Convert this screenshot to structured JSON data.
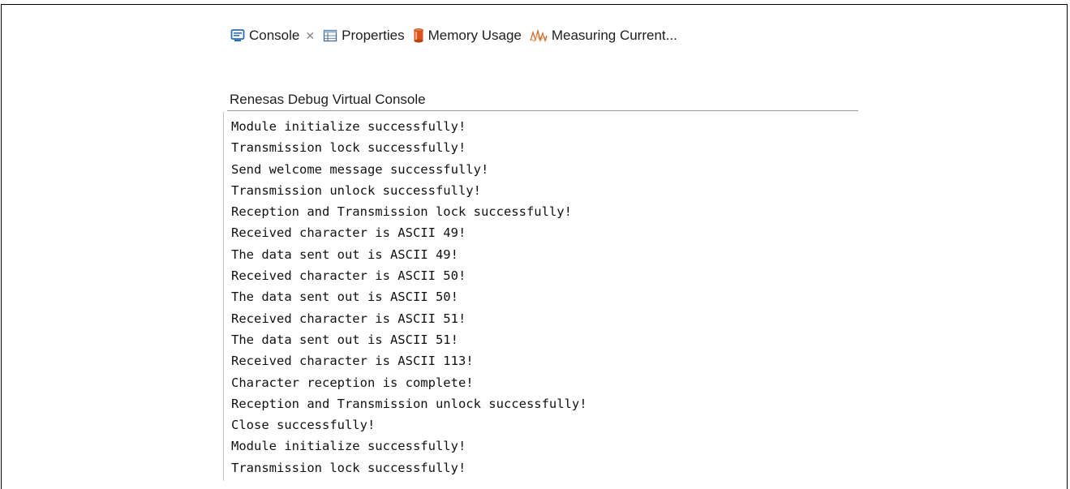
{
  "tabs": [
    {
      "label": "Console",
      "icon": "console-icon",
      "closable": true,
      "active": true
    },
    {
      "label": "Properties",
      "icon": "properties-icon",
      "closable": false
    },
    {
      "label": "Memory Usage",
      "icon": "memory-icon",
      "closable": false
    },
    {
      "label": "Measuring Current...",
      "icon": "measuring-icon",
      "closable": false
    }
  ],
  "close_glyph": "✕",
  "console": {
    "title": "Renesas Debug Virtual Console",
    "lines": [
      "Module initialize successfully!",
      "Transmission lock successfully!",
      "Send welcome message successfully!",
      "Transmission unlock successfully!",
      "Reception and Transmission lock successfully!",
      "Received character is ASCII 49!",
      "The data sent out is ASCII 49!",
      "Received character is ASCII 50!",
      "The data sent out is ASCII 50!",
      "Received character is ASCII 51!",
      "The data sent out is ASCII 51!",
      "Received character is ASCII 113!",
      "Character reception is complete!",
      "Reception and Transmission unlock successfully!",
      "Close successfully!",
      "Module initialize successfully!",
      "Transmission lock successfully!"
    ]
  },
  "colors": {
    "console_icon": "#2a6fb5",
    "memory_icon": "#d9531e",
    "measuring_icon": "#c56a2a"
  }
}
